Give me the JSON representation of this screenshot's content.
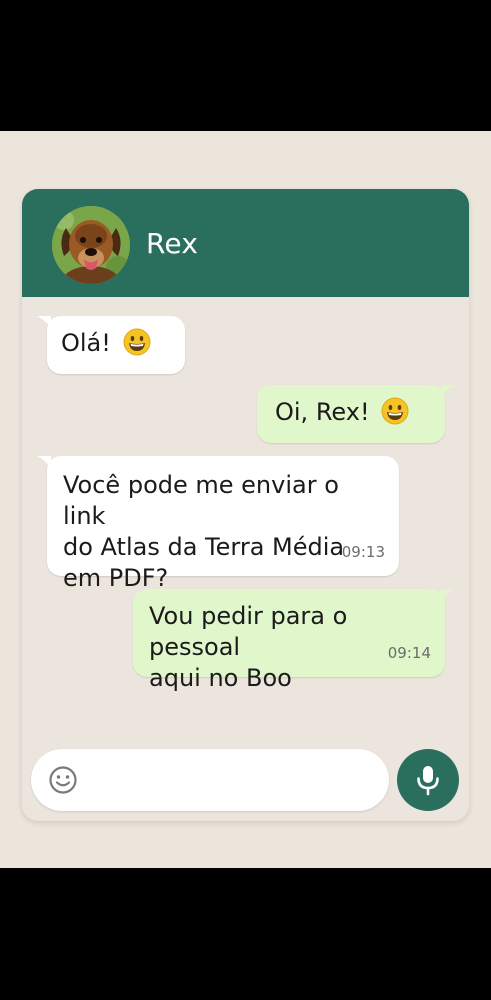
{
  "contact": {
    "name": "Rex",
    "avatar_icon": "dog-avatar"
  },
  "messages": [
    {
      "direction": "incoming",
      "text": "Olá!",
      "emoji": "grinning-face-emoji",
      "time": ""
    },
    {
      "direction": "outgoing",
      "text": "Oi, Rex!",
      "emoji": "grinning-face-emoji",
      "time": ""
    },
    {
      "direction": "incoming",
      "text": "Você pode me enviar o link\ndo Atlas da Terra Média\nem PDF?",
      "time": "09:13"
    },
    {
      "direction": "outgoing",
      "text": "Vou pedir para o pessoal\naqui no Boo",
      "time": "09:14"
    }
  ],
  "composer": {
    "value": "",
    "placeholder": "",
    "emoji_icon": "smiley-icon",
    "send_icon": "microphone-icon"
  },
  "colors": {
    "header": "#2a6e5e",
    "incoming_bubble": "#ffffff",
    "outgoing_bubble": "#e0f6cb",
    "background": "#ece5dd"
  }
}
